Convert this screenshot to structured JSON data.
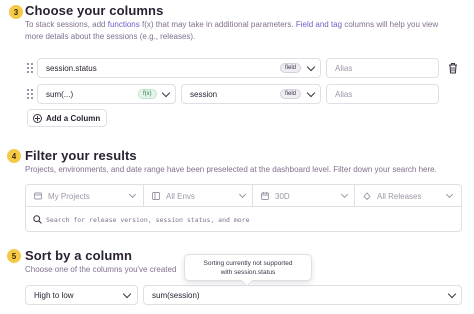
{
  "step1": {
    "number": "3",
    "title": "Choose your columns",
    "desc_part1": "To stack sessions, add ",
    "desc_link1": "functions",
    "desc_part2": " f(x) that may take in additional parameters. ",
    "desc_link2": "Field and tag",
    "desc_part3": " columns will help you view",
    "desc_line2": "more details about the sessions (e.g., releases).",
    "rows": [
      {
        "value": "session.status",
        "kind_pill": "field",
        "alias_placeholder": "Alias"
      },
      {
        "value": "sum(...)",
        "kind_pill": "f(x)",
        "param_value": "session",
        "param_pill": "field",
        "alias_placeholder": "Alias"
      }
    ],
    "add_column_label": "Add a Column"
  },
  "step2": {
    "number": "4",
    "title": "Filter your results",
    "desc": "Projects, environments, and date range have been preselected at the dashboard level. Filter down your search here.",
    "filters": [
      "My Projects",
      "All Envs",
      "30D",
      "All Releases"
    ],
    "search_placeholder": "Search for release version, session status, and more"
  },
  "step3": {
    "number": "5",
    "title": "Sort by a column",
    "desc": "Choose one of the columns you've created",
    "order_value": "High to low",
    "sort_value": "sum(session)",
    "tooltip_line1": "Sorting currently not supported",
    "tooltip_line2": "with session.status"
  },
  "colors": {
    "accent": "#6c5fc7",
    "badge": "#f7c948",
    "border": "#e2dee6",
    "muted": "#80708f"
  },
  "icons": [
    "drag-handle-icon",
    "trash-icon",
    "chevron-down-icon",
    "add-circle-icon",
    "project-icon",
    "environment-icon",
    "calendar-icon",
    "release-icon",
    "search-icon"
  ]
}
